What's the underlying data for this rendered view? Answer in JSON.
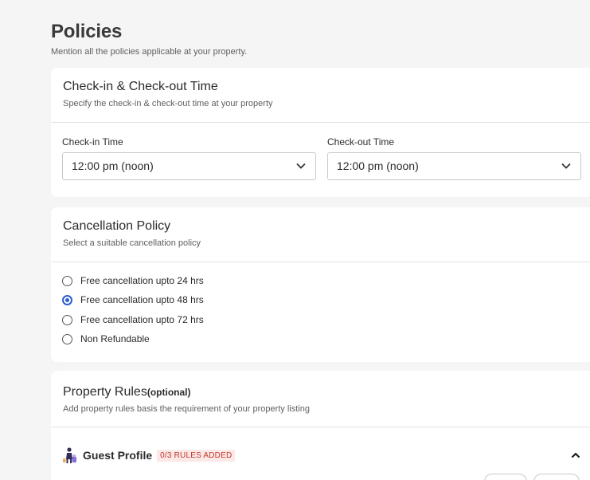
{
  "header": {
    "title": "Policies",
    "subtitle": "Mention all the policies applicable at your property."
  },
  "checkin": {
    "title": "Check-in & Check-out Time",
    "subtitle": "Specify the check-in & check-out time at your property",
    "checkin_label": "Check-in Time",
    "checkin_value": "12:00 pm (noon)",
    "checkout_label": "Check-out Time",
    "checkout_value": "12:00 pm (noon)"
  },
  "cancellation": {
    "title": "Cancellation Policy",
    "subtitle": "Select a suitable cancellation policy",
    "options": [
      {
        "label": "Free cancellation upto 24 hrs",
        "checked": false
      },
      {
        "label": "Free cancellation upto 48 hrs",
        "checked": true
      },
      {
        "label": "Free cancellation upto 72 hrs",
        "checked": false
      },
      {
        "label": "Non Refundable",
        "checked": false
      }
    ]
  },
  "rules": {
    "title": "Property Rules",
    "optional": "(optional)",
    "subtitle": "Add property rules basis the requirement of your property listing",
    "guest_profile": {
      "icon": "guest-luggage-icon",
      "title": "Guest Profile",
      "badge": "0/3 RULES ADDED"
    }
  },
  "colors": {
    "accent": "#2d5fd0",
    "badge_bg": "#fde8e8",
    "badge_text": "#c0392b",
    "page_bg": "#f5f5f5"
  }
}
